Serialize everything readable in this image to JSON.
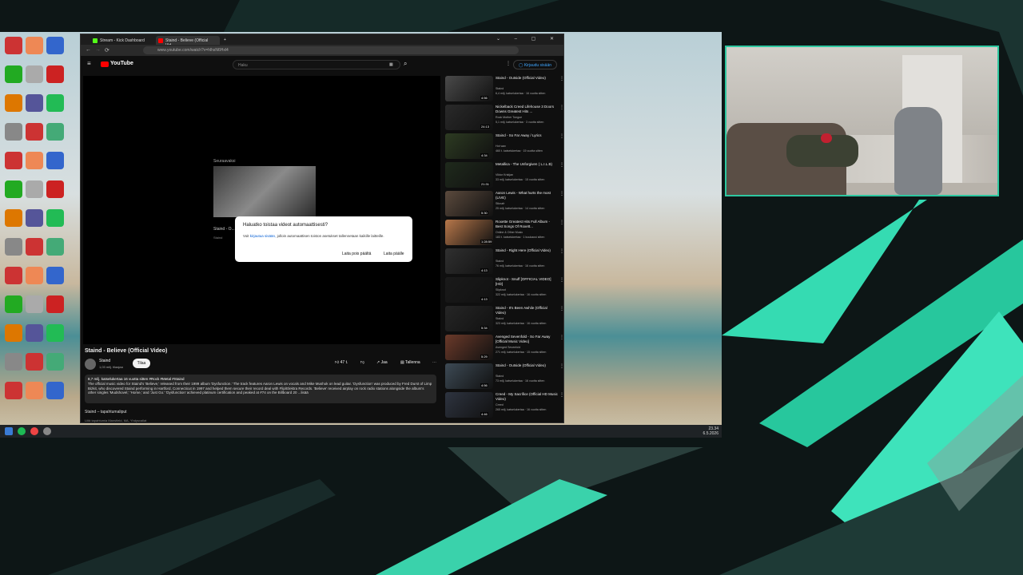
{
  "browser": {
    "tabs": [
      {
        "label": "Stream - Kick Dashboard",
        "color": "#53fc18"
      },
      {
        "label": "Staind - Believe (Official Vid...",
        "color": "#ff0000"
      }
    ],
    "url": "www.youtube.com/watch?v=hlhsN6Hxl4"
  },
  "youtube": {
    "logo": "YouTube",
    "search_placeholder": "Haku",
    "signin": "Kirjaudu sisään",
    "next_label": "Seuraavaksi",
    "next_title": "Staind - O...",
    "next_channel": "Staind",
    "dialog": {
      "title": "Haluatko toistaa videot automaattisesti?",
      "text_pre": "Voit",
      "text_link": "kirjautua sisään,",
      "text_post": "jolloin automaattisen toiston asetukset tallennetaan kaikille laitteille.",
      "btn_off": "Laita pois päältä",
      "btn_on": "Laita päälle"
    },
    "video_title": "Staind - Believe (Official Video)",
    "channel": "Staind",
    "subscribers": "1,03 milj. tilaajaa",
    "subscribe": "Tilaa",
    "likes": "47 t.",
    "share": "Jaa",
    "save": "Tallenna",
    "desc_meta": "8,7 milj. katselukertaa  16 vuotta sitten  #Rock #Metal #Staind",
    "desc_text": "The official music video for Staind's 'Believe,' released from their 1999 album 'Dysfunction.' The track features Aaron Lewis on vocals and Mike Mushok on lead guitar. 'Dysfunction' was produced by Fred Durst of Limp Bizkit, who discovered Staind performing in Hartford, Connecticut in 1997 and helped them secure their record deal with Flip/Elektra Records. 'Believe' received airplay on rock radio stations alongside the album's other singles 'Mudshovel,' 'Home,' and 'Just Go.' 'Dysfunction' achieved platinum certification and peaked at #74 on the Billboard 20 ...lisää",
    "events": "Staind – tapahtumaliput",
    "chapters": "Liitä tapahtumia  Mansfield, MA, Yhdysvallat"
  },
  "recommendations": [
    {
      "title": "Staind - Outside (Official Video)",
      "channel": "Staind",
      "meta": "6,4 milj. katselukertaa · 16 vuotta sitten",
      "duration": "4:56",
      "color": "#4a4a4a"
    },
    {
      "title": "Nickelback Creed Lifehouse 3 Doors Downs Greatest Hits ...",
      "channel": "Rock Mother Tongue",
      "meta": "5,1 milj. katselukertaa · 3 vuotta sitten",
      "duration": "24:13",
      "color": "#2a2a2a"
    },
    {
      "title": "Staind - So Far Away / Lyrics",
      "channel": "Hot wax",
      "meta": "460 t. katselukertaa · 15 vuotta sitten",
      "duration": "4:34",
      "color": "#2d3b22"
    },
    {
      "title": "Metallica - The Unforgiven ( L.I.L.B)",
      "channel": "Viktor Kristjan",
      "meta": "33 milj. katselukertaa · 15 vuotta sitten",
      "duration": "21:31",
      "color": "#1f2a1c"
    },
    {
      "title": "Aaron Lewis - What hurts the most (LIVE)",
      "channel": "Stknafr",
      "meta": "25 milj. katselukertaa · 14 vuotta sitten",
      "duration": "5:30",
      "color": "#5b4a3d"
    },
    {
      "title": "Roxette Greatest Hits Full Album - Best Songs Of Roxett...",
      "channel": "Online & Other Music",
      "meta": "183 t. katselukertaa · 1 kuukausi sitten",
      "duration": "1:28:59",
      "color": "#b7774a"
    },
    {
      "title": "Staind - Right Here (Official Video)",
      "channel": "Staind",
      "meta": "76 milj. katselukertaa · 16 vuotta sitten",
      "duration": "4:13",
      "color": "#303030"
    },
    {
      "title": "Slipknot - Snuff [OFFICIAL VIDEO] [HD]",
      "channel": "Slipknot",
      "meta": "322 milj. katselukertaa · 16 vuotta sitten",
      "duration": "4:13",
      "color": "#1a1a1a"
    },
    {
      "title": "Staind - It's Been Awhile (Official Video)",
      "channel": "Staind",
      "meta": "323 milj. katselukertaa · 16 vuotta sitten",
      "duration": "5:34",
      "color": "#262626"
    },
    {
      "title": "Avenged Sevenfold - So Far Away [Official Music Video]",
      "channel": "Avenged Sevenfold",
      "meta": "271 milj. katselukertaa · 15 vuotta sitten",
      "duration": "5:29",
      "color": "#6b3a2a"
    },
    {
      "title": "Staind - Outside (Official Video)",
      "channel": "Staind",
      "meta": "73 milj. katselukertaa · 16 vuotta sitten",
      "duration": "4:56",
      "color": "#3d4a55"
    },
    {
      "title": "Creed - My Sacrifice (Official HD Music Video)",
      "channel": "Creed",
      "meta": "265 milj. katselukertaa · 16 vuotta sitten",
      "duration": "4:46",
      "color": "#2e3440"
    }
  ],
  "taskbar": {
    "time": "23.34",
    "date": "6.5.2026"
  },
  "colors": {
    "accent": "#2ec7a0",
    "yt_red": "#ff0000"
  }
}
